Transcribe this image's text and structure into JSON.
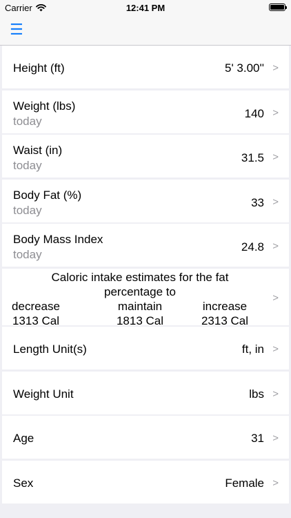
{
  "status_bar": {
    "carrier": "Carrier",
    "time": "12:41 PM",
    "icons": {
      "wifi": "wifi-icon",
      "battery": "battery-icon"
    }
  },
  "nav_bar": {
    "menu_icon": "☰"
  },
  "chevron": ">",
  "rows": {
    "height": {
      "label": "Height (ft)",
      "value": "5' 3.00''"
    },
    "weight": {
      "label": "Weight (lbs)",
      "sub": "today",
      "value": "140"
    },
    "waist": {
      "label": "Waist (in)",
      "sub": "today",
      "value": "31.5"
    },
    "body_fat": {
      "label": "Body Fat (%)",
      "sub": "today",
      "value": "33"
    },
    "bmi": {
      "label": "Body Mass Index",
      "sub": "today",
      "value": "24.8"
    },
    "caloric": {
      "title": "Caloric intake estimates for the fat percentage to",
      "columns": [
        {
          "label": "decrease",
          "value": "1313 Cal"
        },
        {
          "label": "maintain",
          "value": "1813 Cal"
        },
        {
          "label": "increase",
          "value": "2313 Cal"
        }
      ]
    },
    "length_unit": {
      "label": "Length Unit(s)",
      "value": "ft, in"
    },
    "weight_unit": {
      "label": "Weight Unit",
      "value": "lbs"
    },
    "age": {
      "label": "Age",
      "value": "31"
    },
    "sex": {
      "label": "Sex",
      "value": "Female"
    }
  },
  "colors": {
    "accent": "#147efb",
    "secondary_text": "#8e8e93",
    "background": "#efeff4"
  }
}
